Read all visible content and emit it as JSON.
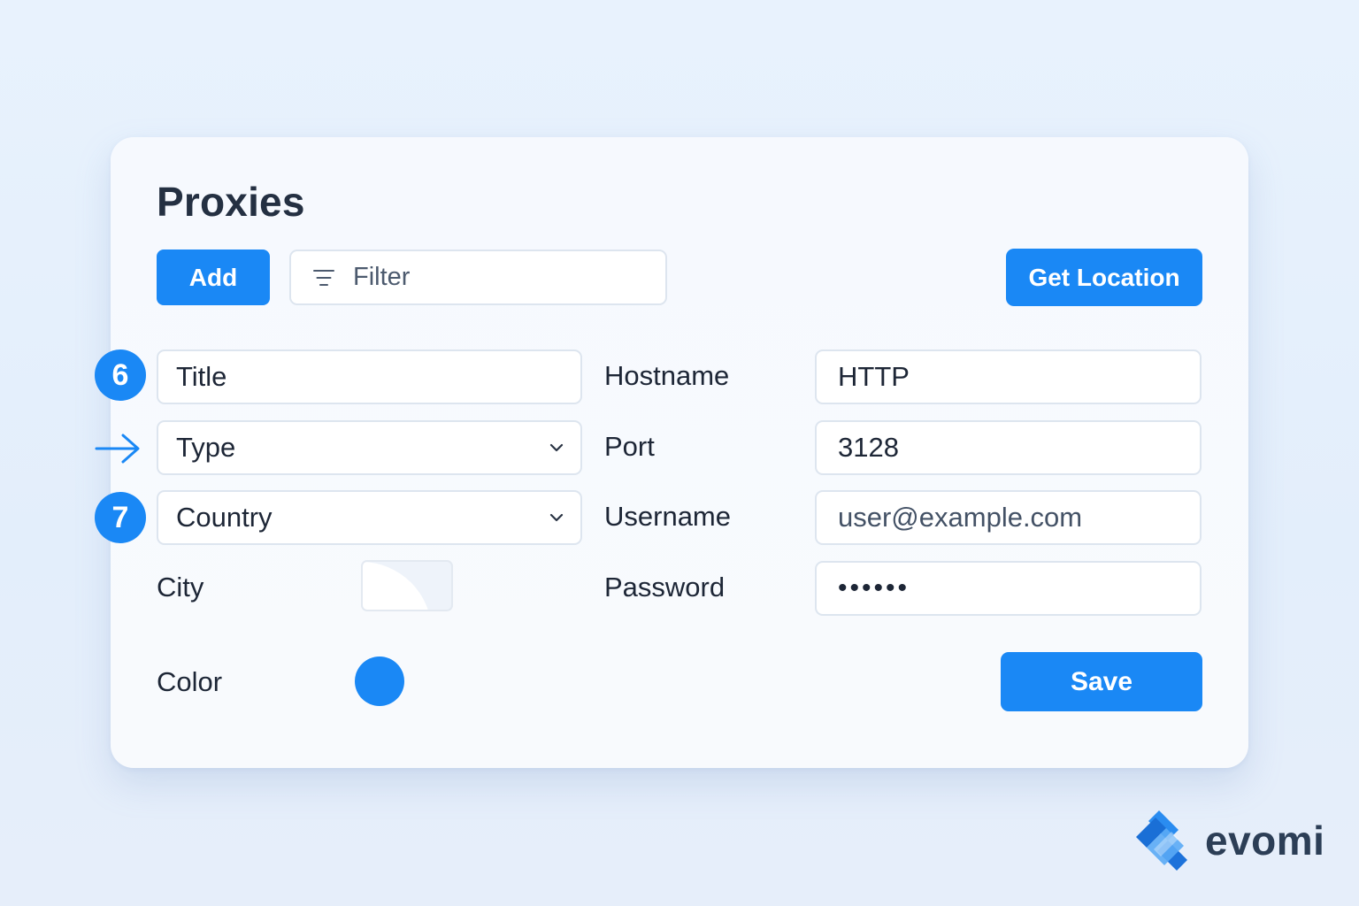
{
  "header": {
    "title": "Proxies"
  },
  "toolbar": {
    "add_label": "Add",
    "filter_placeholder": "Filter",
    "get_location_label": "Get Location"
  },
  "steps": {
    "badge_6": "6",
    "badge_7": "7"
  },
  "form": {
    "title_placeholder": "Title",
    "type_placeholder": "Type",
    "country_placeholder": "Country",
    "city_label": "City",
    "color_label": "Color",
    "color_value": "#1a88f5",
    "hostname_label": "Hostname",
    "hostname_value": "HTTP",
    "port_label": "Port",
    "port_value": "3128",
    "username_label": "Username",
    "username_value": "user@example.com",
    "password_label": "Password",
    "password_value": "••••••",
    "save_label": "Save"
  },
  "brand": {
    "logo_text": "evomi"
  },
  "colors": {
    "accent": "#1a88f5",
    "background": "#e8f2fd",
    "text": "#1d2636"
  }
}
